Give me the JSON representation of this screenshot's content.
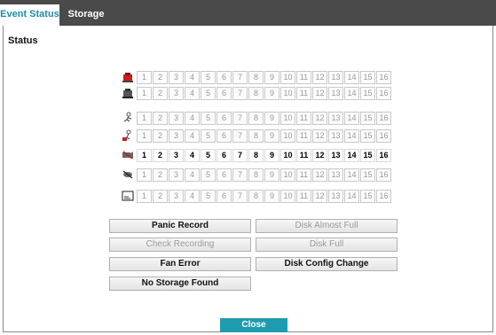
{
  "tabs": [
    {
      "label": "Event Status",
      "active": true
    },
    {
      "label": "Storage",
      "active": false
    }
  ],
  "section_title": "Status",
  "numbers": [
    "1",
    "2",
    "3",
    "4",
    "5",
    "6",
    "7",
    "8",
    "9",
    "10",
    "11",
    "12",
    "13",
    "14",
    "15",
    "16"
  ],
  "rows": [
    {
      "icon": "alarm-in-icon",
      "active": false
    },
    {
      "icon": "alarm-out-icon",
      "active": false
    },
    {
      "icon": "motion-icon",
      "active": false
    },
    {
      "icon": "motion-alarm-icon",
      "active": false
    },
    {
      "icon": "video-loss-icon",
      "active": true
    },
    {
      "icon": "tampering-icon",
      "active": false
    },
    {
      "icon": "text-in-icon",
      "active": false
    }
  ],
  "buttons": {
    "panic_record": "Panic Record",
    "disk_almost_full": "Disk Almost Full",
    "check_recording": "Check Recording",
    "disk_full": "Disk Full",
    "fan_error": "Fan Error",
    "disk_config_change": "Disk Config Change",
    "no_storage_found": "No Storage Found"
  },
  "close_label": "Close",
  "colors": {
    "accent": "#1f9bb0",
    "tabbar": "#4a4a4a",
    "active_tab_text": "#1f8aa6"
  }
}
